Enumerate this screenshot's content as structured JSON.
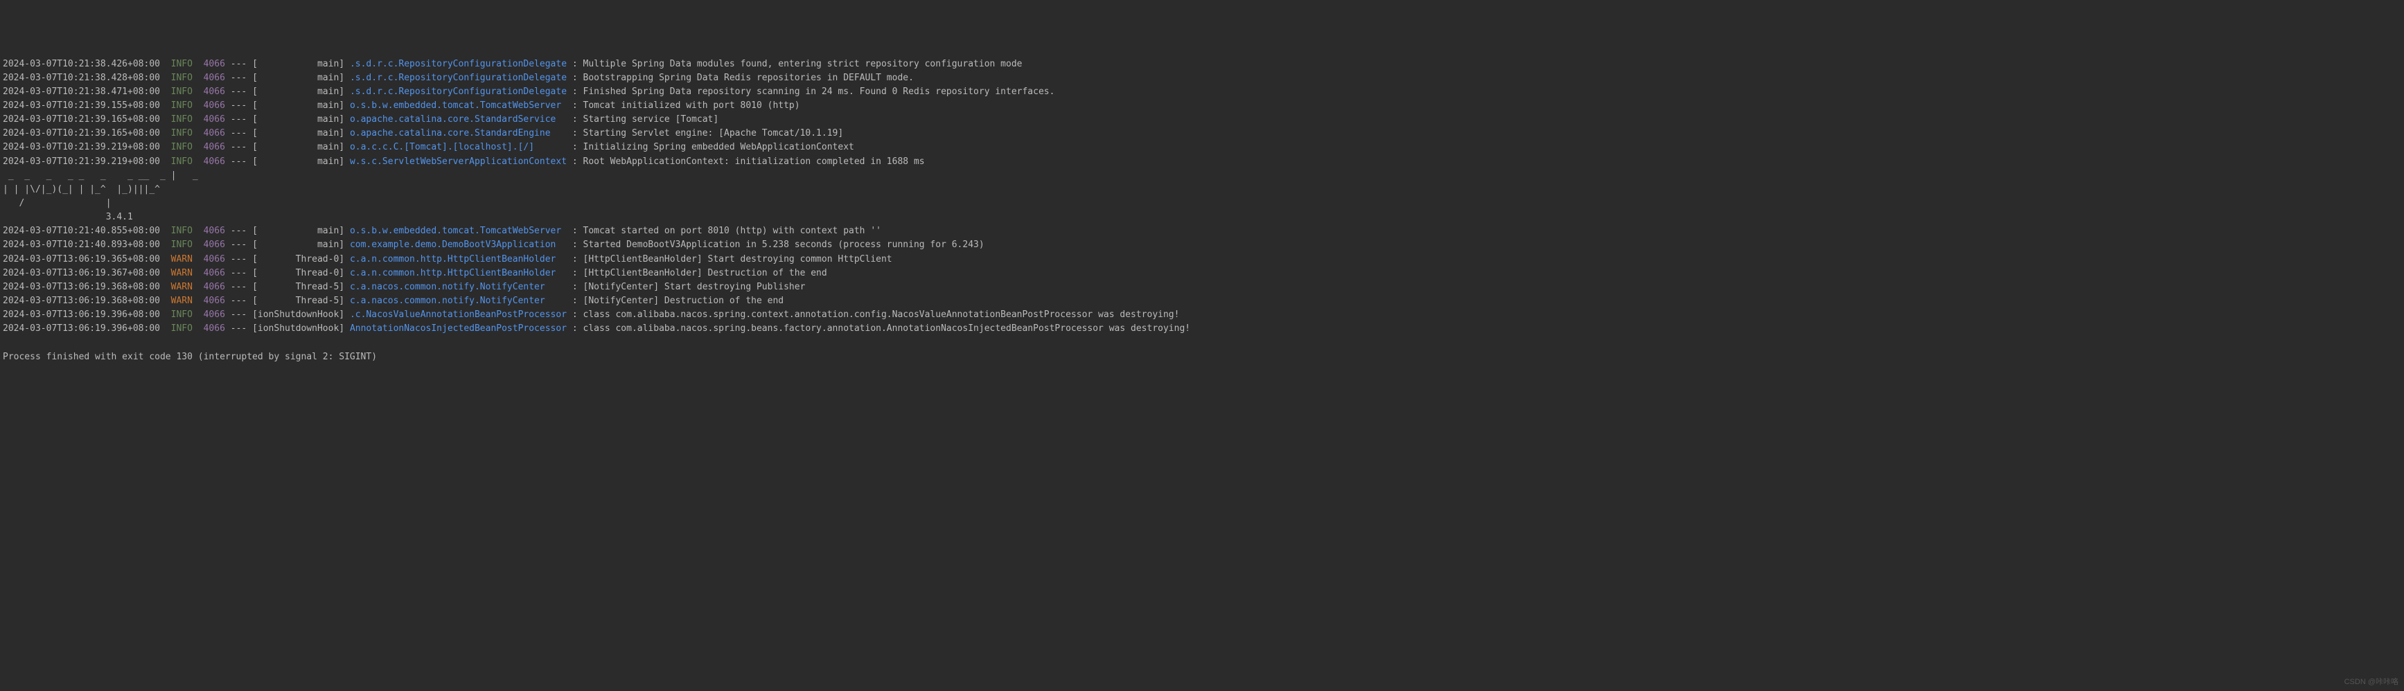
{
  "logs_before_banner": [
    {
      "ts": "2024-03-07T10:21:38.426+08:00",
      "lvl": "INFO",
      "pid": "4066",
      "thread": "           main",
      "logger": ".s.d.r.c.RepositoryConfigurationDelegate",
      "msg": "Multiple Spring Data modules found, entering strict repository configuration mode"
    },
    {
      "ts": "2024-03-07T10:21:38.428+08:00",
      "lvl": "INFO",
      "pid": "4066",
      "thread": "           main",
      "logger": ".s.d.r.c.RepositoryConfigurationDelegate",
      "msg": "Bootstrapping Spring Data Redis repositories in DEFAULT mode."
    },
    {
      "ts": "2024-03-07T10:21:38.471+08:00",
      "lvl": "INFO",
      "pid": "4066",
      "thread": "           main",
      "logger": ".s.d.r.c.RepositoryConfigurationDelegate",
      "msg": "Finished Spring Data repository scanning in 24 ms. Found 0 Redis repository interfaces."
    },
    {
      "ts": "2024-03-07T10:21:39.155+08:00",
      "lvl": "INFO",
      "pid": "4066",
      "thread": "           main",
      "logger": "o.s.b.w.embedded.tomcat.TomcatWebServer ",
      "msg": "Tomcat initialized with port 8010 (http)"
    },
    {
      "ts": "2024-03-07T10:21:39.165+08:00",
      "lvl": "INFO",
      "pid": "4066",
      "thread": "           main",
      "logger": "o.apache.catalina.core.StandardService  ",
      "msg": "Starting service [Tomcat]"
    },
    {
      "ts": "2024-03-07T10:21:39.165+08:00",
      "lvl": "INFO",
      "pid": "4066",
      "thread": "           main",
      "logger": "o.apache.catalina.core.StandardEngine   ",
      "msg": "Starting Servlet engine: [Apache Tomcat/10.1.19]"
    },
    {
      "ts": "2024-03-07T10:21:39.219+08:00",
      "lvl": "INFO",
      "pid": "4066",
      "thread": "           main",
      "logger": "o.a.c.c.C.[Tomcat].[localhost].[/]      ",
      "msg": "Initializing Spring embedded WebApplicationContext"
    },
    {
      "ts": "2024-03-07T10:21:39.219+08:00",
      "lvl": "INFO",
      "pid": "4066",
      "thread": "           main",
      "logger": "w.s.c.ServletWebServerApplicationContext",
      "msg": "Root WebApplicationContext: initialization completed in 1688 ms"
    }
  ],
  "banner": {
    "l1": " _  _   _   _ _   _    _ __  _ |   _ ",
    "l2": "| | |\\/|_)(_| | |_^  |_)|||_^",
    "l3": "   /               |         ",
    "l4": "                   3.4.1"
  },
  "logs_after_banner": [
    {
      "ts": "2024-03-07T10:21:40.855+08:00",
      "lvl": "INFO",
      "pid": "4066",
      "thread": "           main",
      "logger": "o.s.b.w.embedded.tomcat.TomcatWebServer ",
      "msg": "Tomcat started on port 8010 (http) with context path ''"
    },
    {
      "ts": "2024-03-07T10:21:40.893+08:00",
      "lvl": "INFO",
      "pid": "4066",
      "thread": "           main",
      "logger": "com.example.demo.DemoBootV3Application  ",
      "msg": "Started DemoBootV3Application in 5.238 seconds (process running for 6.243)"
    },
    {
      "ts": "2024-03-07T13:06:19.365+08:00",
      "lvl": "WARN",
      "pid": "4066",
      "thread": "       Thread-0",
      "logger": "c.a.n.common.http.HttpClientBeanHolder  ",
      "msg": "[HttpClientBeanHolder] Start destroying common HttpClient"
    },
    {
      "ts": "2024-03-07T13:06:19.367+08:00",
      "lvl": "WARN",
      "pid": "4066",
      "thread": "       Thread-0",
      "logger": "c.a.n.common.http.HttpClientBeanHolder  ",
      "msg": "[HttpClientBeanHolder] Destruction of the end"
    },
    {
      "ts": "2024-03-07T13:06:19.368+08:00",
      "lvl": "WARN",
      "pid": "4066",
      "thread": "       Thread-5",
      "logger": "c.a.nacos.common.notify.NotifyCenter    ",
      "msg": "[NotifyCenter] Start destroying Publisher"
    },
    {
      "ts": "2024-03-07T13:06:19.368+08:00",
      "lvl": "WARN",
      "pid": "4066",
      "thread": "       Thread-5",
      "logger": "c.a.nacos.common.notify.NotifyCenter    ",
      "msg": "[NotifyCenter] Destruction of the end"
    },
    {
      "ts": "2024-03-07T13:06:19.396+08:00",
      "lvl": "INFO",
      "pid": "4066",
      "thread": "ionShutdownHook",
      "logger": ".c.NacosValueAnnotationBeanPostProcessor",
      "msg": "class com.alibaba.nacos.spring.context.annotation.config.NacosValueAnnotationBeanPostProcessor was destroying!"
    },
    {
      "ts": "2024-03-07T13:06:19.396+08:00",
      "lvl": "INFO",
      "pid": "4066",
      "thread": "ionShutdownHook",
      "logger": "AnnotationNacosInjectedBeanPostProcessor",
      "msg": "class com.alibaba.nacos.spring.beans.factory.annotation.AnnotationNacosInjectedBeanPostProcessor was destroying!"
    }
  ],
  "exit_message": "Process finished with exit code 130 (interrupted by signal 2: SIGINT)",
  "watermark": "CSDN @咔咔咯"
}
